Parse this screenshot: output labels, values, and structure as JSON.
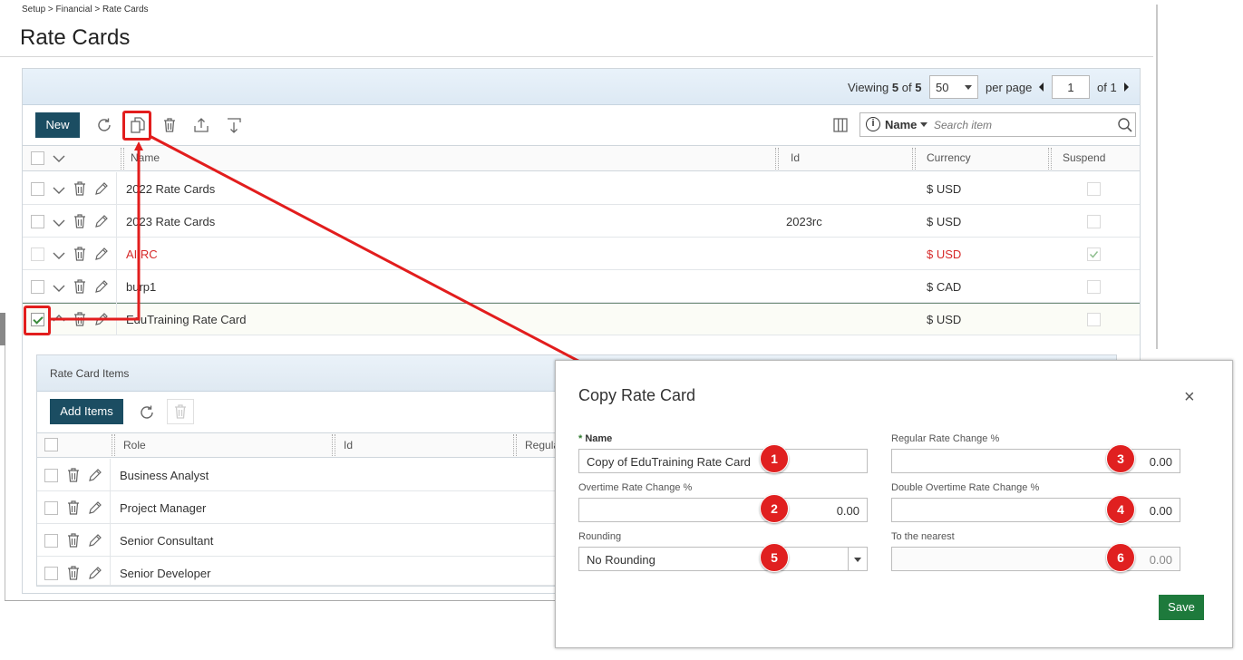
{
  "breadcrumb": "Setup > Financial > Rate Cards",
  "page_title": "Rate Cards",
  "pager": {
    "viewing_prefix": "Viewing",
    "viewing_count": "5",
    "viewing_of": "of",
    "viewing_total": "5",
    "per_page_value": "50",
    "per_page_label": "per page",
    "page_value": "1",
    "of_pages": "of 1"
  },
  "toolbar": {
    "new_label": "New",
    "search_field": "Name",
    "search_placeholder": "Search item"
  },
  "columns": {
    "name": "Name",
    "id": "Id",
    "currency": "Currency",
    "suspend": "Suspend"
  },
  "rows": [
    {
      "name": "2022 Rate Cards",
      "id": "",
      "currency": "$ USD"
    },
    {
      "name": "2023 Rate Cards",
      "id": "2023rc",
      "currency": "$ USD"
    },
    {
      "name": "AI RC",
      "id": "",
      "currency": "$ USD"
    },
    {
      "name": "burp1",
      "id": "",
      "currency": "$ CAD"
    },
    {
      "name": "EduTraining Rate Card",
      "id": "",
      "currency": "$ USD"
    }
  ],
  "sub_panel": {
    "title": "Rate Card Items",
    "add_label": "Add Items",
    "columns": {
      "role": "Role",
      "id": "Id",
      "regular": "Regula"
    },
    "rows": [
      {
        "role": "Business Analyst"
      },
      {
        "role": "Project Manager"
      },
      {
        "role": "Senior Consultant"
      },
      {
        "role": "Senior Developer"
      }
    ]
  },
  "modal": {
    "title": "Copy Rate Card",
    "close_glyph": "×",
    "name_required": "*",
    "name_label": "Name",
    "name_value": "Copy of EduTraining Rate Card",
    "regular_label": "Regular Rate Change %",
    "regular_value": "0.00",
    "overtime_label": "Overtime Rate Change %",
    "overtime_value": "0.00",
    "double_label": "Double Overtime Rate Change %",
    "double_value": "0.00",
    "rounding_label": "Rounding",
    "rounding_value": "No Rounding",
    "nearest_label": "To the nearest",
    "nearest_value": "0.00",
    "save_label": "Save"
  },
  "badges": [
    "1",
    "2",
    "3",
    "4",
    "5",
    "6"
  ],
  "colors": {
    "primary_button": "#1b4d62",
    "save_button": "#1e7a3c",
    "annotation_red": "#e21d1d",
    "suspended_text": "#d62a2a"
  }
}
